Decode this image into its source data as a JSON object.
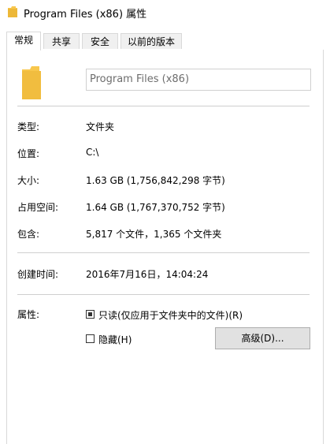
{
  "window": {
    "title": "Program Files (x86) 属性"
  },
  "tabs": [
    {
      "label": "常规"
    },
    {
      "label": "共享"
    },
    {
      "label": "安全"
    },
    {
      "label": "以前的版本"
    }
  ],
  "general": {
    "name_value": "Program Files (x86)",
    "rows": [
      {
        "label": "类型:",
        "value": "文件夹"
      },
      {
        "label": "位置:",
        "value": "C:\\"
      },
      {
        "label": "大小:",
        "value": "1.63 GB (1,756,842,298 字节)"
      },
      {
        "label": "占用空间:",
        "value": "1.64 GB (1,767,370,752 字节)"
      },
      {
        "label": "包含:",
        "value": "5,817 个文件，1,365 个文件夹"
      }
    ],
    "created": {
      "label": "创建时间:",
      "value": "2016年7月16日，14:04:24"
    },
    "attributes": {
      "label": "属性:",
      "readonly_label": "只读(仅应用于文件夹中的文件)(R)",
      "hidden_label": "隐藏(H)",
      "advanced_button": "高级(D)..."
    }
  },
  "colors": {
    "folder": "#f8c74d",
    "folder_dark": "#e6ae2b",
    "button_bg": "#e1e1e1"
  }
}
